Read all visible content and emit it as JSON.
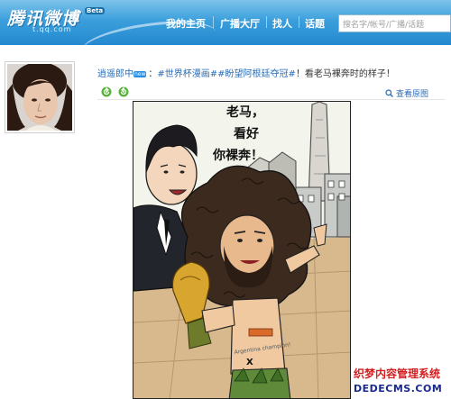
{
  "header": {
    "logo_text": "腾讯微博",
    "beta_badge": "Beta",
    "domain": "t.qq.com",
    "nav": [
      "我的主页",
      "广播大厅",
      "找人",
      "话题"
    ],
    "search_placeholder": "搜名字/帐号/广播/话题"
  },
  "post": {
    "author": "逍遥郎中",
    "new_badge": "new",
    "topic1": "#世界杯漫画#",
    "topic2": "#盼望阿根廷夺冠#",
    "text": "！看老马裸奔时的样子！",
    "view_large": "查看原图"
  },
  "comic": {
    "speech": [
      "老马，",
      "看好",
      "你裸奔！"
    ],
    "shorts_mark": "X",
    "tattoo_text": "Argentina champion!"
  },
  "watermark": {
    "line1": "织梦内容管理系统",
    "line2": "DEDECMS.COM"
  },
  "colors": {
    "header_blue": "#2489cf",
    "link_blue": "#2a6cb6",
    "watermark_red": "#d42020",
    "watermark_navy": "#1a2a8c"
  }
}
